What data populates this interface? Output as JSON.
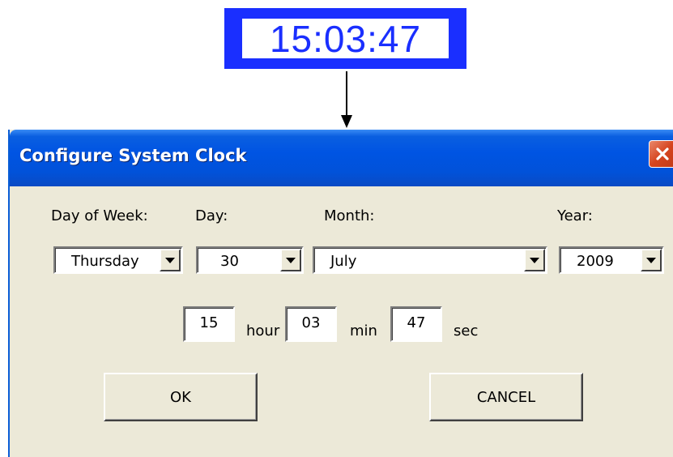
{
  "clock_display": {
    "time": "15:03:47",
    "color": "#1a2fff"
  },
  "dialog": {
    "title": "Configure System Clock",
    "close_icon": "close-x-icon",
    "labels": {
      "day_of_week": "Day of Week:",
      "day": "Day:",
      "month": "Month:",
      "year": "Year:"
    },
    "selects": {
      "day_of_week": "Thursday",
      "day": "30",
      "month": "July",
      "year": "2009"
    },
    "time": {
      "hour_value": "15",
      "hour_unit": "hour",
      "min_value": "03",
      "min_unit": "min",
      "sec_value": "47",
      "sec_unit": "sec"
    },
    "buttons": {
      "ok": "OK",
      "cancel": "CANCEL"
    }
  }
}
